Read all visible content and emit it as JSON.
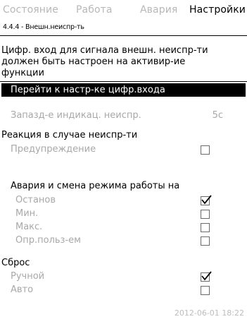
{
  "tabs": [
    "Состояние",
    "Работа",
    "Авария",
    "Настройки"
  ],
  "active_tab": "Настройки",
  "breadcrumb": "4.4.4 - Внешн.неиспр-ть",
  "description_lines": [
    "Цифр. вход для сигнала внешн. неиспр-ти",
    "должен быть настроен на активир-ие",
    "функции"
  ],
  "goto_button": "Перейти к настр-ке цифр.входа",
  "delay": {
    "label": "Запазд-е индикац. неиспр.",
    "value": "5с"
  },
  "reaction": {
    "header": "Реакция в случае неиспр-ти",
    "warning_label": "Предупреждение",
    "warning_checked": false
  },
  "alarm": {
    "header": "Авария и смена режима работы на",
    "options": [
      {
        "label": "Останов",
        "checked": true
      },
      {
        "label": "Мин.",
        "checked": false
      },
      {
        "label": "Макс.",
        "checked": false
      },
      {
        "label": "Опр.польз-ем",
        "checked": false
      }
    ]
  },
  "reset": {
    "header": "Сброс",
    "options": [
      {
        "label": "Ручной",
        "checked": true
      },
      {
        "label": "Авто",
        "checked": false
      }
    ]
  },
  "datetime": "2012-06-01 18:22"
}
